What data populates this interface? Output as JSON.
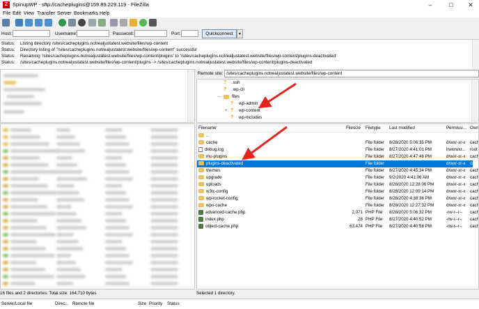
{
  "window": {
    "title": "SpinupWP - sftp://cacheplugins@159.89.229.119 - FileZilla"
  },
  "menu": [
    "File",
    "Edit",
    "View",
    "Transfer",
    "Server",
    "Bookmarks",
    "Help"
  ],
  "quickconnect": {
    "host_label": "Host:",
    "username_label": "Username:",
    "password_label": "Password:",
    "port_label": "Port:",
    "button": "Quickconnect",
    "host": "",
    "username": "",
    "password": "",
    "port": ""
  },
  "log": [
    {
      "label": "Status:",
      "text": "Listing directory /sites/cacheplugins.notrealjustatest.website/files/wp-content"
    },
    {
      "label": "Status:",
      "text": "Directory listing of \"/sites/cacheplugins.notrealjustatest.website/files/wp-content\" successful"
    },
    {
      "label": "Status:",
      "text": "Renaming '/sites/cacheplugins.notrealjustatest.website/files/wp-content/plugins' to '/sites/cacheplugins.notrealjustatest.website/files/wp-content/plugins-deactivated'"
    },
    {
      "label": "Status:",
      "text": "/sites/cacheplugins.notrealjustatest.website/files/wp-content/plugins -> /sites/cacheplugins.notrealjustatest.website/files/wp-content/plugins-deactivated"
    }
  ],
  "remote": {
    "site_label": "Remote site:",
    "path": "/sites/cacheplugins.notrealjustatest.website/files/wp-content",
    "tree": [
      ".ssh",
      ".wp-cli",
      "files",
      "wp-admin",
      "wp-content",
      "wp-includes"
    ],
    "columns": [
      "Filename",
      "Filesize",
      "Filetype",
      "Last modified",
      "Permissi...",
      "Own"
    ],
    "rows": [
      {
        "name": "..",
        "size": "",
        "type": "",
        "modified": "",
        "perm": "",
        "owner": "",
        "icon": "folder"
      },
      {
        "name": "cache",
        "size": "",
        "type": "File folder",
        "modified": "8/28/2020 5:06:35 PM",
        "perm": "drwxr-xr-x",
        "owner": "cach",
        "icon": "folder"
      },
      {
        "name": "debug.log",
        "size": "",
        "type": "File folder",
        "modified": "8/27/2020 4:41:01 PM",
        "perm": "lrwxrwxr...",
        "owner": "root",
        "icon": "file"
      },
      {
        "name": "mu-plugins",
        "size": "",
        "type": "File folder",
        "modified": "8/27/2020 4:47:46 PM",
        "perm": "drwxr-xr-x",
        "owner": "cach",
        "icon": "folder"
      },
      {
        "name": "plugins-deactivated",
        "size": "",
        "type": "File folder",
        "modified": "",
        "perm": "drwxr-xr-x",
        "owner": "cach",
        "icon": "folder"
      },
      {
        "name": "themes",
        "size": "",
        "type": "File folder",
        "modified": "8/27/2020 4:45:34 PM",
        "perm": "drwxr-xr-x",
        "owner": "cach",
        "icon": "folder"
      },
      {
        "name": "upgrade",
        "size": "",
        "type": "File folder",
        "modified": "9/2/2020 4:41:06 AM",
        "perm": "drwxr-xr-x",
        "owner": "cach",
        "icon": "folder"
      },
      {
        "name": "uploads",
        "size": "",
        "type": "File folder",
        "modified": "8/28/2020 12:28:06 PM",
        "perm": "drwxr-xr-x",
        "owner": "cach",
        "icon": "folder"
      },
      {
        "name": "w3tc-config",
        "size": "",
        "type": "File folder",
        "modified": "8/28/2020 12:09:14 PM",
        "perm": "drwxr-xr-x",
        "owner": "cach",
        "icon": "folder"
      },
      {
        "name": "wp-rocket-config",
        "size": "",
        "type": "File folder",
        "modified": "8/28/2020 4:38:36 PM",
        "perm": "drwxr-xr-x",
        "owner": "cach",
        "icon": "folder"
      },
      {
        "name": "wpo-cache",
        "size": "",
        "type": "File folder",
        "modified": "8/28/2020 12:27:32 PM",
        "perm": "drwxr-xr-x",
        "owner": "cach",
        "icon": "folder"
      },
      {
        "name": "advanced-cache.php",
        "size": "2,071",
        "type": "PHP File",
        "modified": "8/28/2020 5:06:32 PM",
        "perm": "-rw-r--r--",
        "owner": "cach",
        "icon": "php"
      },
      {
        "name": "index.php",
        "size": "28",
        "type": "PHP File",
        "modified": "8/27/2020 4:40:52 PM",
        "perm": "-rw-r--r--",
        "owner": "cach",
        "icon": "php"
      },
      {
        "name": "object-cache.php",
        "size": "63,474",
        "type": "PHP File",
        "modified": "8/27/2020 4:40:58 PM",
        "perm": "-rw-r--r--",
        "owner": "cach",
        "icon": "php"
      }
    ],
    "selected_index": 4,
    "status": "Selected 1 directory."
  },
  "local": {
    "status": "16 files and 2 directories. Total size: 164,710 bytes"
  },
  "queue": {
    "columns": [
      "Server/Local file",
      "Direc...",
      "Remote file",
      "Size",
      "Priority",
      "Status"
    ]
  },
  "colors": {
    "selection": "#0078d7",
    "arrow": "#e32420",
    "folder": "#e8c15a"
  }
}
